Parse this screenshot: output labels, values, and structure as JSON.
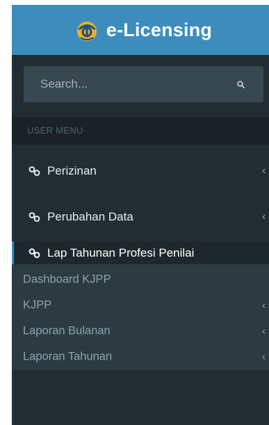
{
  "header": {
    "title": "e-Licensing",
    "logo_icon": "emblem-logo-icon",
    "colors": {
      "header_bg": "#3c8dbc",
      "logo_gold": "#e8b22c",
      "logo_blue": "#1f4e79"
    }
  },
  "sidebar": {
    "search": {
      "placeholder": "Search...",
      "value": "",
      "icon": "search-icon"
    },
    "section_header": "USER MENU",
    "items": [
      {
        "label": "Perizinan",
        "icon": "link-icon",
        "arrow": "‹",
        "active": false
      },
      {
        "label": "Perubahan Data",
        "icon": "link-icon",
        "arrow": "‹",
        "active": false
      },
      {
        "label": "Lap Tahunan Profesi Penilai",
        "icon": "link-icon",
        "arrow": "‹",
        "active": true
      }
    ],
    "submenu": [
      {
        "label": "Dashboard KJPP",
        "arrow": ""
      },
      {
        "label": "KJPP",
        "arrow": "‹"
      },
      {
        "label": "Laporan Bulanan",
        "arrow": "‹"
      },
      {
        "label": "Laporan Tahunan",
        "arrow": "‹"
      }
    ],
    "colors": {
      "sidebar_bg": "#222d32",
      "search_bg": "#374850",
      "header_band": "#1a2226",
      "active_bg": "#1e282c",
      "active_border": "#3c8dbc",
      "submenu_bg": "#2c3b41",
      "submenu_text": "#8aa4af"
    }
  }
}
